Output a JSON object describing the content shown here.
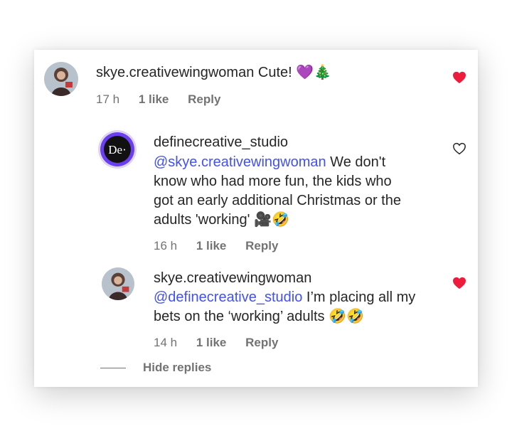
{
  "comments": [
    {
      "username": "skye.creativewingwoman",
      "text": "Cute! 💜🎄",
      "time": "17 h",
      "likes": "1 like",
      "reply": "Reply",
      "liked": true
    },
    {
      "username": "definecreative_studio",
      "avatar_text": "De·",
      "mention": "@skye.creativewingwoman",
      "text_line1_rest": " We don't",
      "text_line2": "know who had more fun, the kids who",
      "text_line3": "got an early additional Christmas or the",
      "text_line4": "adults 'working' 🎥🤣",
      "time": "16 h",
      "likes": "1 like",
      "reply": "Reply",
      "liked": false
    },
    {
      "username": "skye.creativewingwoman",
      "mention": "@definecreative_studio",
      "text_line1_rest": " I’m placing all my",
      "text_line2": "bets on the ‘working’ adults 🤣🤣",
      "time": "14 h",
      "likes": "1 like",
      "reply": "Reply",
      "liked": true
    }
  ],
  "hide_replies": "Hide replies",
  "colors": {
    "heart_liked": "#ed1c3c",
    "mention": "#4150f7",
    "meta": "#737373"
  }
}
